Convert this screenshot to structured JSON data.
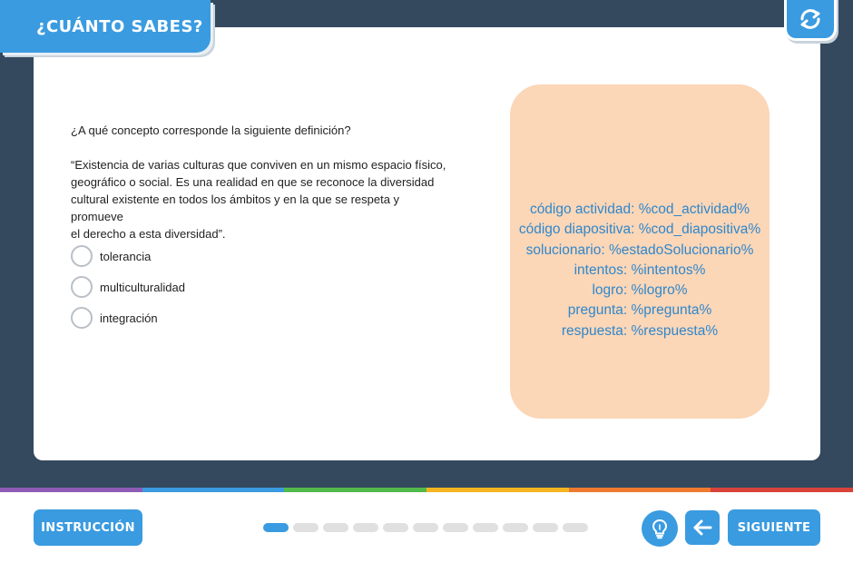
{
  "header": {
    "title": "¿CUÁNTO SABES?",
    "reload_icon": "reload-icon"
  },
  "question": {
    "prompt": "¿A qué concepto corresponde la siguiente definición?",
    "definition": "“Existencia de varias culturas que conviven en un mismo espacio físico,\ngeográfico o social. Es una realidad en que se reconoce la diversidad\ncultural existente en todos los ámbitos y en la que se respeta y promueve\nel derecho a esta diversidad”."
  },
  "options": [
    {
      "label": "tolerancia"
    },
    {
      "label": "multiculturalidad"
    },
    {
      "label": "integración"
    }
  ],
  "info": {
    "lines": [
      "código actividad: %cod_actividad%",
      "código diapositiva: %cod_diapositiva%",
      "solucionario: %estadoSolucionario%",
      "intentos: %intentos%",
      "logro: %logro%",
      "pregunta: %pregunta%",
      "respuesta: %respuesta%"
    ]
  },
  "footer": {
    "instruccion_label": "INSTRUCCIÓN",
    "siguiente_label": "SIGUIENTE",
    "hint_icon": "lightbulb-icon",
    "back_icon": "arrow-left-icon",
    "progress_total": 11,
    "progress_current": 1
  },
  "colors": {
    "accent": "#3a9be0",
    "background": "#34495e",
    "info_panel": "#fbd6b7",
    "info_text": "#2f87cc",
    "rainbow": [
      "#8e5bb5",
      "#3a9be0",
      "#53b94a",
      "#f5b520",
      "#ee7a2f",
      "#d8423a"
    ]
  }
}
